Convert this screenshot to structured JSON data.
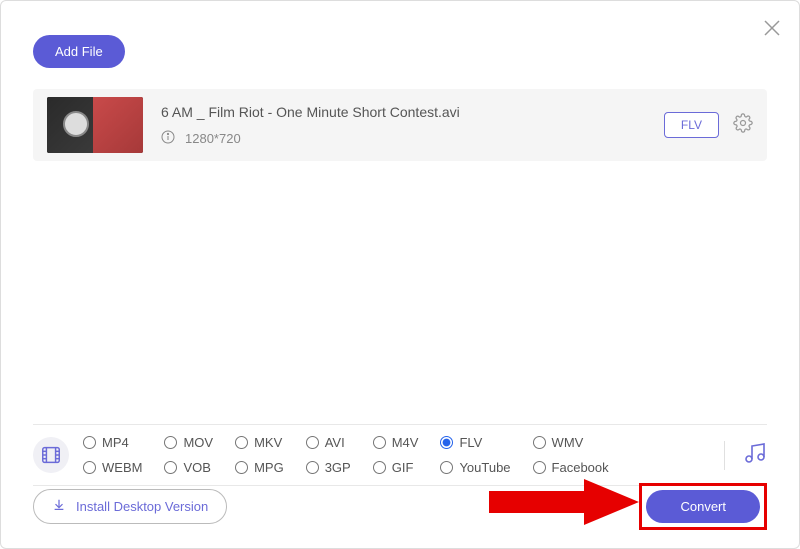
{
  "header": {
    "add_file_label": "Add File"
  },
  "file": {
    "title": "6 AM _ Film Riot - One Minute Short Contest.avi",
    "resolution": "1280*720",
    "format_badge": "FLV"
  },
  "formats": {
    "row1": [
      "MP4",
      "MOV",
      "MKV",
      "AVI",
      "M4V",
      "FLV",
      "WMV"
    ],
    "row2": [
      "WEBM",
      "VOB",
      "MPG",
      "3GP",
      "GIF",
      "YouTube",
      "Facebook"
    ],
    "selected": "FLV"
  },
  "footer": {
    "install_label": "Install Desktop Version",
    "convert_label": "Convert"
  }
}
